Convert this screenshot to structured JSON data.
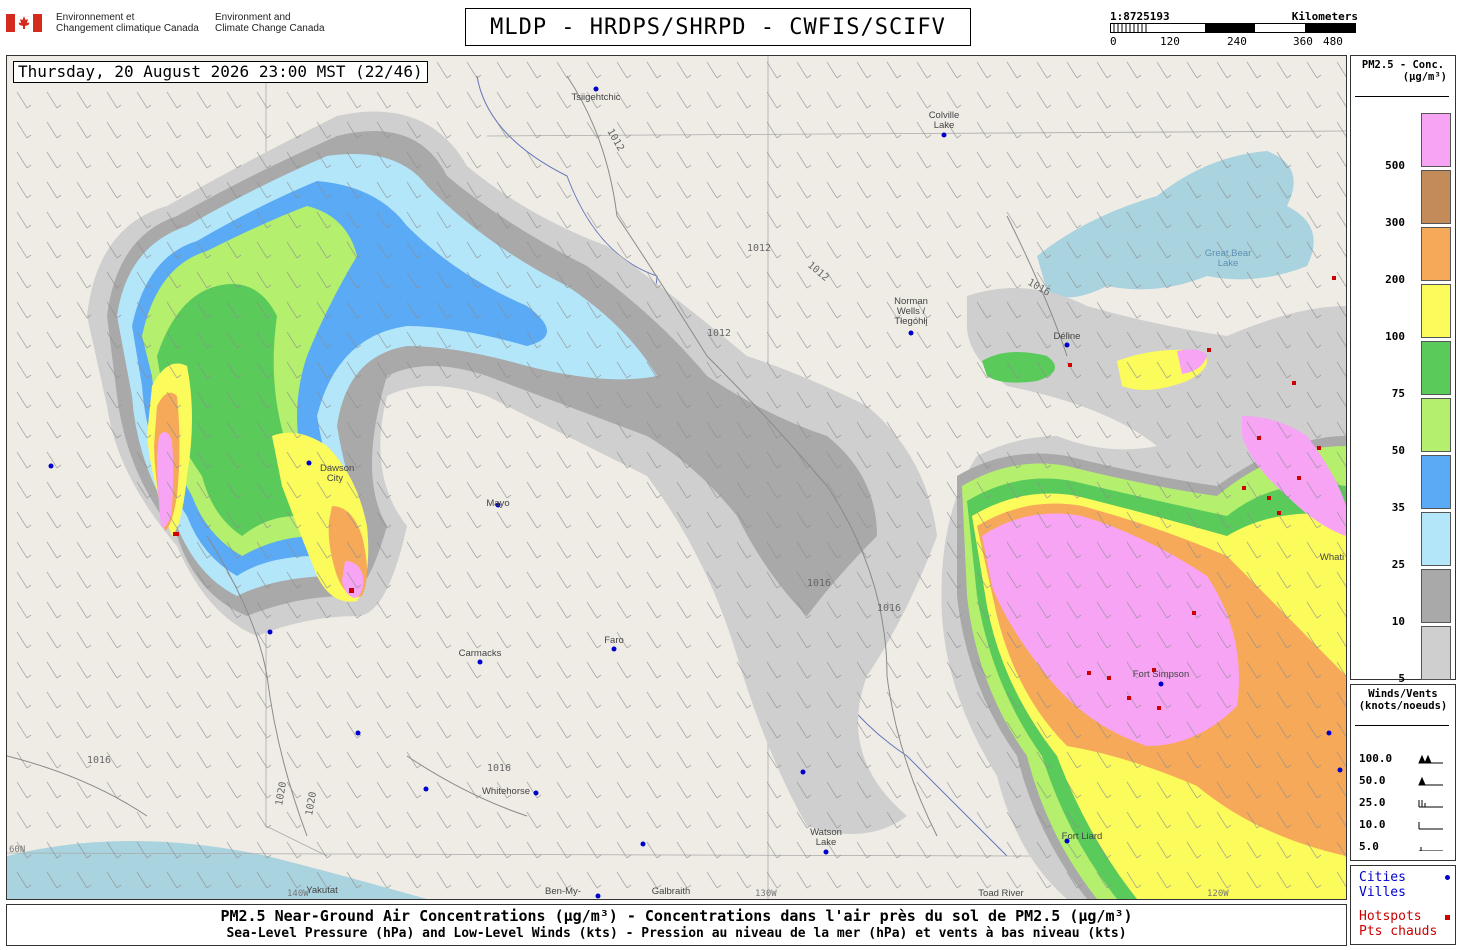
{
  "header": {
    "gov_fr": "Environnement et\nChangement climatique Canada",
    "gov_en": "Environment and\nClimate Change Canada",
    "title": "MLDP - HRDPS/SHRPD - CWFIS/SCIFV"
  },
  "scale_bar": {
    "ratio": "1:8725193",
    "unit": "Kilometers",
    "ticks": [
      "0",
      "120",
      "240",
      "360",
      "480"
    ]
  },
  "map": {
    "date_label": "Thursday, 20 August 2026 23:00 MST (22/46)",
    "cities": [
      "Tsiigehtchic",
      "Colville Lake",
      "Great Bear Lake",
      "Norman Wells / Tłegóhłį",
      "Déline",
      "Dawson City",
      "Mayo",
      "Carmacks",
      "Faro",
      "Whitehorse",
      "Watson Lake",
      "Fort Liard",
      "Yakutat",
      "Ben-My-",
      "Galbraith",
      "Toad River",
      "Fort Simpson",
      "Whati"
    ],
    "isobar_labels": [
      "1012",
      "1016",
      "1020"
    ],
    "graticule_labels": [
      "60N",
      "130W",
      "120W",
      "140W"
    ]
  },
  "legend_pm": {
    "title": "PM2.5 - Conc.",
    "unit": "(µg/m³)",
    "levels": [
      {
        "label": "500",
        "color": "#f7a4f5"
      },
      {
        "label": "300",
        "color": "#c38a5a"
      },
      {
        "label": "200",
        "color": "#f7a95a"
      },
      {
        "label": "100",
        "color": "#fbfb5c"
      },
      {
        "label": "75",
        "color": "#5acb5a"
      },
      {
        "label": "50",
        "color": "#b4ef6e"
      },
      {
        "label": "35",
        "color": "#5aaaf5"
      },
      {
        "label": "25",
        "color": "#b4e6fa"
      },
      {
        "label": "10",
        "color": "#a9a9a9"
      },
      {
        "label": "5",
        "color": "#cfcfcf"
      }
    ]
  },
  "legend_wind": {
    "title": "Winds/Vents",
    "unit": "(knots/noeuds)",
    "speeds": [
      "100.0",
      "50.0",
      "25.0",
      "10.0",
      "5.0"
    ]
  },
  "legend_cities": {
    "cities_en": "Cities",
    "cities_fr": "Villes",
    "hotspots_en": "Hotspots",
    "hotspots_fr": "Pts chauds",
    "city_color": "#0000cc",
    "hotspot_color": "#cc0000"
  },
  "footer": {
    "line1": "PM2.5 Near-Ground Air Concentrations (µg/m³) - Concentrations dans l'air près du sol de PM2.5 (µg/m³)",
    "line2": "Sea-Level Pressure (hPa) and Low-Level Winds (kts) - Pression au niveau de la mer (hPa) et vents à bas niveau (kts)"
  }
}
